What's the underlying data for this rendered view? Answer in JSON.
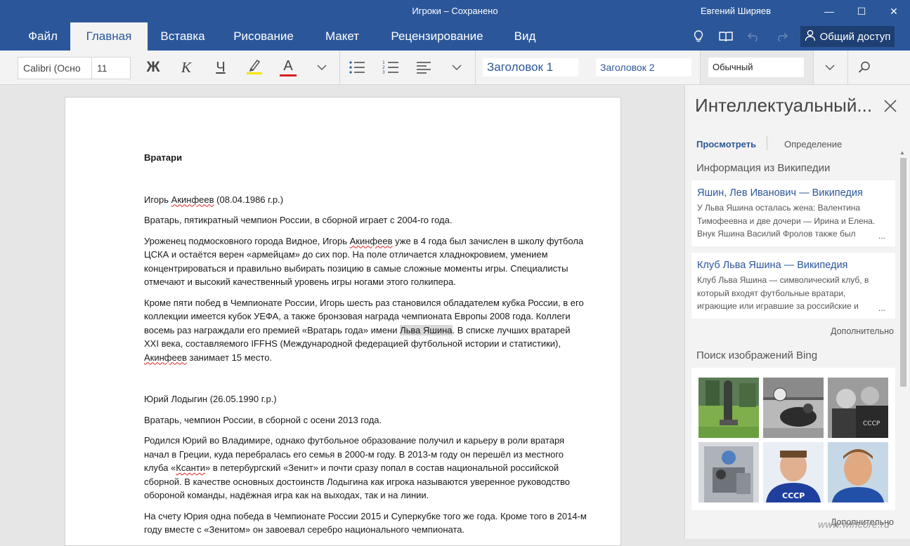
{
  "titlebar": {
    "doc_title": "Игроки – Сохранено",
    "user_name": "Евгений Ширяев",
    "minimize_glyph": "—",
    "maximize_glyph": "☐",
    "close_glyph": "✕"
  },
  "tabs": [
    {
      "label": "Файл"
    },
    {
      "label": "Главная",
      "active": true
    },
    {
      "label": "Вставка"
    },
    {
      "label": "Рисование"
    },
    {
      "label": "Макет"
    },
    {
      "label": "Рецензирование"
    },
    {
      "label": "Вид"
    }
  ],
  "share": {
    "label": "Общий доступ"
  },
  "ribbon": {
    "font_name": "Calibri (Осно",
    "font_size": "11",
    "bold": "Ж",
    "italic": "К",
    "underline": "Ч",
    "font_color": "А",
    "highlight_color": "#f5e400",
    "font_color_bar": "#d92020",
    "styles": [
      "Заголовок 1",
      "Заголовок 2"
    ],
    "style_current": "Обычный"
  },
  "document": {
    "heading": "Вратари",
    "p1": {
      "pre": "Игорь ",
      "squig": "Акинфеев",
      "post": " (08.04.1986 г.р.)"
    },
    "p2": "Вратарь, пятикратный чемпион России, в сборной играет с 2004-го года.",
    "p3": {
      "pre": "Уроженец подмосковного города Видное, Игорь ",
      "squig": "Акинфеев",
      "post": " уже в 4 года был зачислен в школу футбола ЦСКА и остаётся верен «армейцам» до сих пор. На поле отличается хладнокровием, умением концентрироваться и правильно выбирать позицию в самые сложные моменты игры. Специалисты отмечают и высокий качественный уровень игры ногами этого голкипера."
    },
    "p4": {
      "pre": "Кроме пяти побед в Чемпионате России, Игорь шесть раз становился обладателем кубка России, в его коллекции имеется кубок УЕФА, а также бронзовая награда чемпионата Европы 2008 года. Коллеги восемь раз награждали его премией «Вратарь года» имени ",
      "highlight": "Льва Яшина",
      "mid": ". В списке лучших вратарей XXI века, составляемого IFFHS (Международной федерацией футбольной истории и статистики), ",
      "squig": "Акинфеев",
      "post": " занимает 15 место."
    },
    "p5": "Юрий Лодыгин (26.05.1990 г.р.)",
    "p6": "Вратарь, чемпион России, в сборной с осени 2013 года.",
    "p7": {
      "pre": "Родился Юрий во Владимире, однако футбольное образование получил и карьеру в роли вратаря начал в Греции, куда перебралась его семья в 2000-м году. В 2013-м году он перешёл из местного клуба «",
      "squig": "Ксанти",
      "post": "» в петербургский «Зенит» и почти сразу попал в состав национальной российской сборной. В качестве основных достоинств Лодыгина как игрока называются уверенное руководство обороной команды, надёжная игра как на выходах, так и на линии."
    },
    "p8": "На счету Юрия одна победа в Чемпионате России 2015 и Суперкубке того же года. Кроме того в 2014-м году вместе с «Зенитом» он завоевал серебро национального чемпионата."
  },
  "pane": {
    "title": "Интеллектуальный...",
    "tab_view": "Просмотреть",
    "tab_definition": "Определение",
    "wiki_section": "Информация из Википедии",
    "wiki_results": [
      {
        "title": "Яшин, Лев Иванович — Википедия",
        "snippet": "У Льва Яшина осталась жена: Валентина Тимофеевна и две дочери — Ирина и Елена. Внук Яшина Василий Фролов также был",
        "ellipsis": "..."
      },
      {
        "title": "Клуб Льва Яшина — Википедия",
        "snippet": "Клуб Льва Яшина — символический клуб, в который входят футбольные вратари, играющие или игравшие за российские и",
        "ellipsis": "..."
      }
    ],
    "more_label": "Дополнительно",
    "images_section": "Поиск изображений Bing",
    "image_badge": "СССР",
    "more_label_2": "Дополнительно"
  },
  "watermark": "www.wincore.ru",
  "colors": {
    "accent": "#2b579a",
    "ribbon_bg": "#f3f3f3"
  }
}
